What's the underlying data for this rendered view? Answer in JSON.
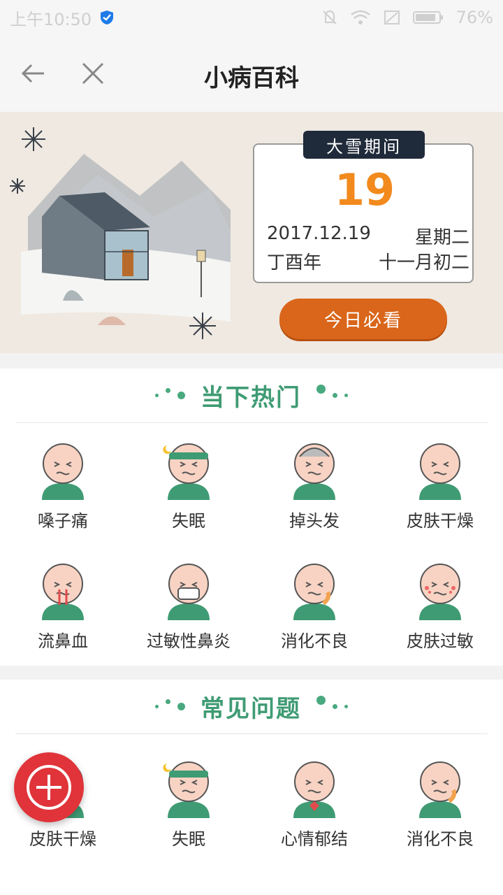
{
  "status_bar": {
    "time": "上午10:50",
    "battery": "76%"
  },
  "header": {
    "title": "小病百科"
  },
  "banner": {
    "tag": "大雪期间",
    "day": "19",
    "date": "2017.12.19",
    "weekday": "星期二",
    "year_name": "丁酉年",
    "lunar_date": "十一月初二",
    "cta_label": "今日必看"
  },
  "sections": [
    {
      "title": "当下热门",
      "items": [
        {
          "label": "嗓子痛",
          "icon": "sore-throat-icon"
        },
        {
          "label": "失眠",
          "icon": "insomnia-icon"
        },
        {
          "label": "掉头发",
          "icon": "hair-loss-icon"
        },
        {
          "label": "皮肤干燥",
          "icon": "dry-skin-icon"
        },
        {
          "label": "流鼻血",
          "icon": "nosebleed-icon"
        },
        {
          "label": "过敏性鼻炎",
          "icon": "allergic-rhinitis-icon"
        },
        {
          "label": "消化不良",
          "icon": "indigestion-icon"
        },
        {
          "label": "皮肤过敏",
          "icon": "skin-allergy-icon"
        }
      ]
    },
    {
      "title": "常见问题",
      "items": [
        {
          "label": "皮肤干燥",
          "icon": "dry-skin-icon"
        },
        {
          "label": "失眠",
          "icon": "insomnia-icon"
        },
        {
          "label": "心情郁结",
          "icon": "depressed-icon"
        },
        {
          "label": "消化不良",
          "icon": "indigestion-icon"
        }
      ]
    }
  ],
  "colors": {
    "accent_green": "#3f9b73",
    "orange": "#f28a1e",
    "cta": "#d9661a",
    "fab": "#e0343a"
  }
}
